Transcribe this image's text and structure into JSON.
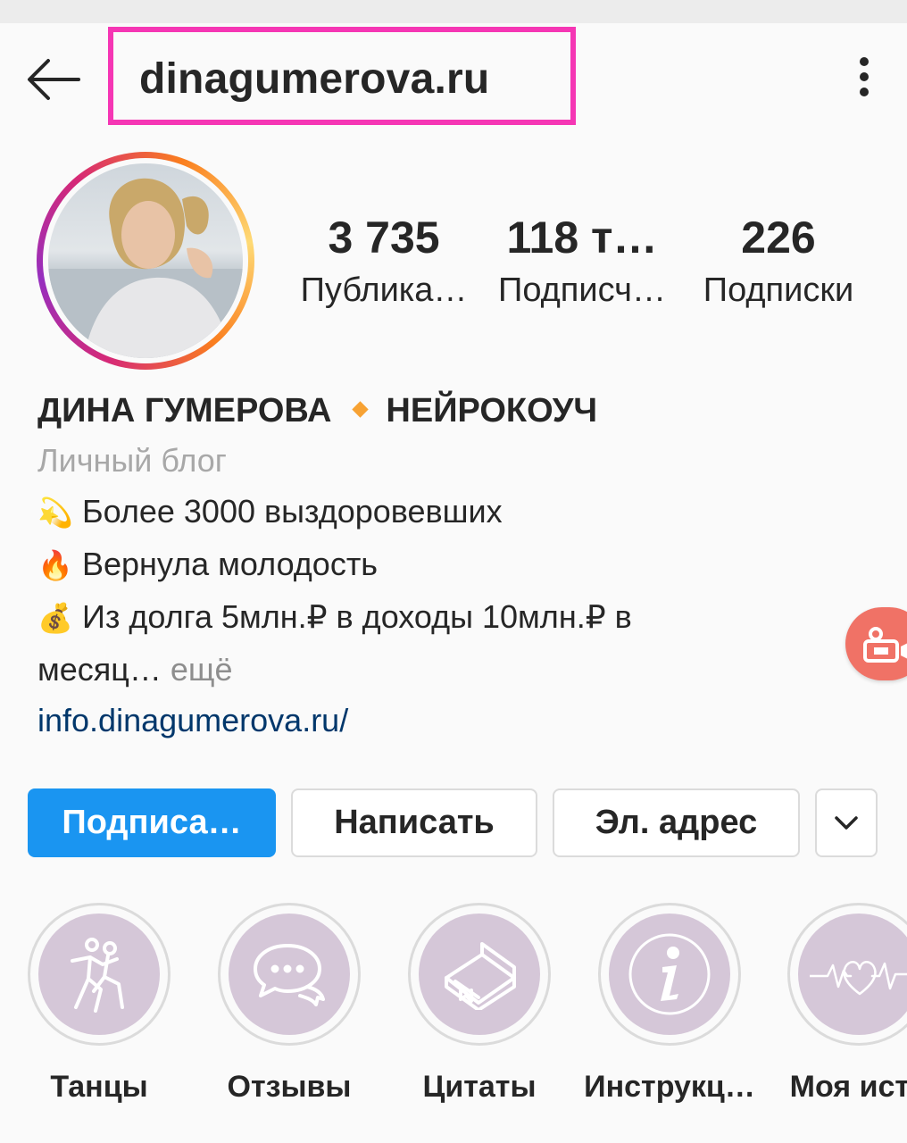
{
  "header": {
    "username": "dinagumerova.ru",
    "back_icon": "arrow-left-icon",
    "more_icon": "more-vertical-icon",
    "highlight_color": "#f536b4"
  },
  "stats": {
    "posts": {
      "value": "3 735",
      "label": "Публика…"
    },
    "followers": {
      "value": "118 т…",
      "label": "Подписч…"
    },
    "following": {
      "value": "226",
      "label": "Подписки"
    }
  },
  "bio": {
    "name": "ДИНА ГУМЕРОВА",
    "title": "НЕЙРОКОУЧ",
    "category": "Личный блог",
    "lines": [
      {
        "emoji": "💫",
        "text": "Более 3000 выздоровевших"
      },
      {
        "emoji": "🔥",
        "text": "Вернула молодость"
      },
      {
        "emoji": "💰",
        "text": "Из долга 5млн.₽ в доходы 10млн.₽ в"
      }
    ],
    "continuation": "месяц…",
    "more_label": "ещё",
    "link": "info.dinagumerova.ru/"
  },
  "actions": {
    "follow": "Подписа…",
    "message": "Написать",
    "email": "Эл. адрес",
    "dropdown_icon": "chevron-down-icon",
    "follow_color": "#1a95f1"
  },
  "highlights": [
    {
      "label": "Танцы",
      "icon": "dancing-couple-icon"
    },
    {
      "label": "Отзывы",
      "icon": "chat-bubbles-icon"
    },
    {
      "label": "Цитаты",
      "icon": "book-icon"
    },
    {
      "label": "Инструкц…",
      "icon": "info-icon"
    },
    {
      "label": "Моя исто",
      "icon": "heart-pulse-icon"
    }
  ]
}
